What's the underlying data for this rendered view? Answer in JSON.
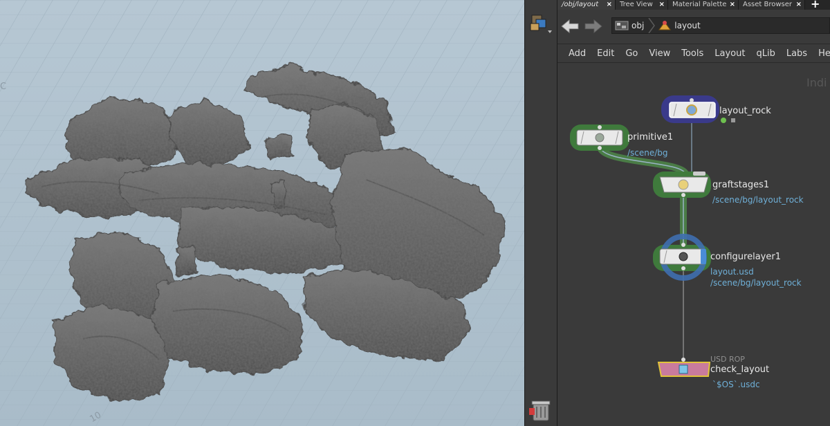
{
  "network": {
    "tabs": [
      {
        "label": "/obj/layout",
        "active": true
      },
      {
        "label": "Tree View",
        "active": false
      },
      {
        "label": "Material Palette",
        "active": false
      },
      {
        "label": "Asset Browser",
        "active": false
      }
    ],
    "tab_close_glyph": "×",
    "tab_add_glyph": "+",
    "path": [
      {
        "label": "obj",
        "icon": "obj-network-icon"
      },
      {
        "label": "layout",
        "icon": "layout-lop-icon"
      }
    ],
    "menu": [
      "Add",
      "Edit",
      "Go",
      "View",
      "Tools",
      "Layout",
      "qLib",
      "Labs",
      "Help"
    ],
    "corner_label": "Indi",
    "nodes": {
      "layout_rock": {
        "name": "layout_rock"
      },
      "primitive1": {
        "name": "primitive1",
        "sub": "/scene/bg"
      },
      "graftstages1": {
        "name": "graftstages1",
        "sub": "/scene/bg/layout_rock"
      },
      "configurelayer1": {
        "name": "configurelayer1",
        "sub1": "layout.usd",
        "sub2": "/scene/bg/layout_rock"
      },
      "check_layout": {
        "name": "check_layout",
        "type_label": "USD ROP",
        "sub": "`$OS`.usdc"
      }
    }
  },
  "viewport": {
    "corner_left": "C",
    "corner_bottom": "10"
  },
  "colors": {
    "viewport_bg": "#b0c2cf",
    "rock": "#5d5d5d",
    "node_green_ring": "#3f7a3c",
    "node_blue_ring": "#3f6fb0",
    "node_purple_ring": "#3a3a8a",
    "rop_pink": "#c97b9d",
    "rop_outline": "#e1c43a",
    "path_blue": "#6fb0d8"
  }
}
